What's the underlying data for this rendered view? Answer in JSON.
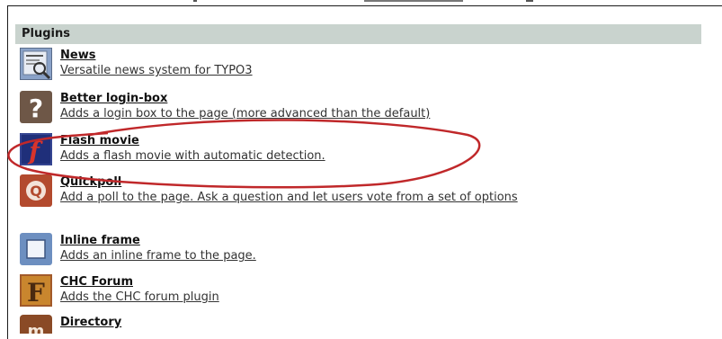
{
  "header": {
    "title": "Plugins"
  },
  "plugins": [
    {
      "title": "News",
      "desc": "Versatile news system for TYPO3",
      "icon": "news-icon"
    },
    {
      "title": "Better login-box",
      "desc": "Adds a login box to the page (more advanced than the default)",
      "icon": "question-mark-icon"
    },
    {
      "title": "Flash movie",
      "desc": "Adds a flash movie with automatic detection.",
      "icon": "flash-icon"
    },
    {
      "title": "Quickpoll",
      "desc": "Add a poll to the page. Ask a question and let users vote from a set of options",
      "icon": "quickpoll-icon"
    },
    {
      "title": "Inline frame",
      "desc": "Adds an inline frame to the page.",
      "icon": "inline-frame-icon"
    },
    {
      "title": "CHC Forum",
      "desc": "Adds the CHC forum plugin",
      "icon": "forum-icon"
    },
    {
      "title": "Directory",
      "desc": "",
      "icon": "directory-icon"
    }
  ],
  "colors": {
    "header_bg": "#c9d3ce",
    "annotation": "#c0282a",
    "text": "#111111"
  }
}
